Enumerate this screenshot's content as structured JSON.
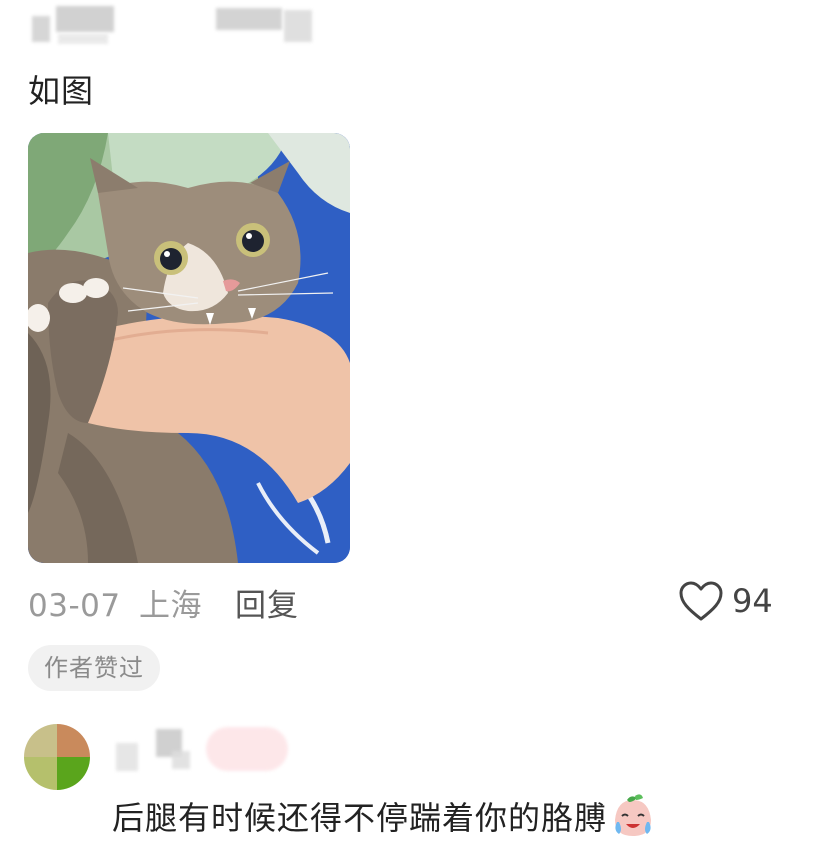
{
  "comment": {
    "text": "如图",
    "date": "03-07",
    "location": "上海",
    "reply_label": "回复",
    "like_count": "94",
    "author_badge": "作者赞过"
  },
  "reply": {
    "text": "后腿有时候还得不停踹着你的胳膊",
    "emoji_icon": "crying-face-emoji"
  },
  "icons": {
    "like": "heart-outline-icon"
  }
}
